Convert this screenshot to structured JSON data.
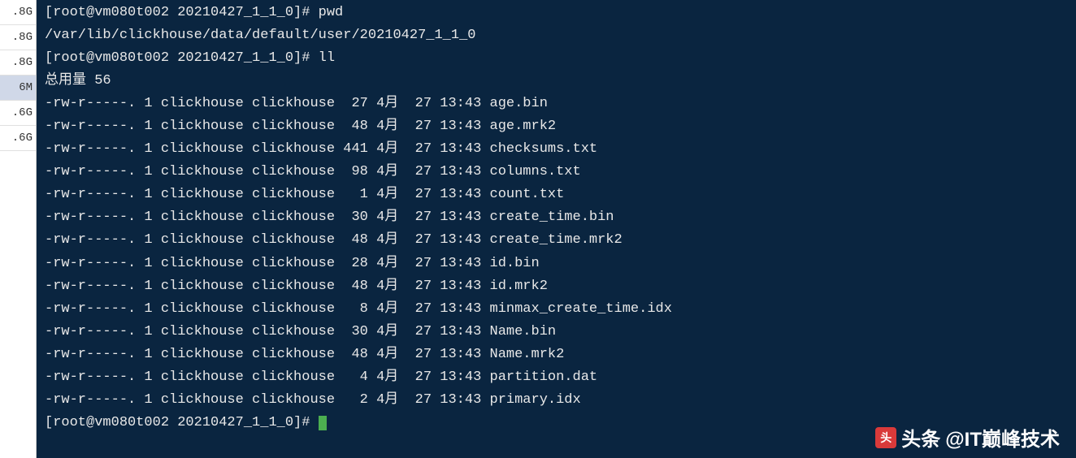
{
  "sidebar": {
    "items": [
      {
        "label": ".8G"
      },
      {
        "label": ".8G"
      },
      {
        "label": ".8G"
      },
      {
        "label": "6M"
      },
      {
        "label": ".6G"
      },
      {
        "label": ".6G"
      }
    ]
  },
  "terminal": {
    "prompt1": "[root@vm080t002 20210427_1_1_0]# ",
    "cmd1": "pwd",
    "path": "/var/lib/clickhouse/data/default/user/20210427_1_1_0",
    "prompt2": "[root@vm080t002 20210427_1_1_0]# ",
    "cmd2": "ll",
    "total": "总用量 56",
    "files": [
      {
        "perms": "-rw-r-----.",
        "links": "1",
        "owner": "clickhouse",
        "group": "clickhouse",
        "size": "27",
        "month": "4月",
        "day": "27",
        "time": "13:43",
        "name": "age.bin"
      },
      {
        "perms": "-rw-r-----.",
        "links": "1",
        "owner": "clickhouse",
        "group": "clickhouse",
        "size": "48",
        "month": "4月",
        "day": "27",
        "time": "13:43",
        "name": "age.mrk2"
      },
      {
        "perms": "-rw-r-----.",
        "links": "1",
        "owner": "clickhouse",
        "group": "clickhouse",
        "size": "441",
        "month": "4月",
        "day": "27",
        "time": "13:43",
        "name": "checksums.txt"
      },
      {
        "perms": "-rw-r-----.",
        "links": "1",
        "owner": "clickhouse",
        "group": "clickhouse",
        "size": "98",
        "month": "4月",
        "day": "27",
        "time": "13:43",
        "name": "columns.txt"
      },
      {
        "perms": "-rw-r-----.",
        "links": "1",
        "owner": "clickhouse",
        "group": "clickhouse",
        "size": "1",
        "month": "4月",
        "day": "27",
        "time": "13:43",
        "name": "count.txt"
      },
      {
        "perms": "-rw-r-----.",
        "links": "1",
        "owner": "clickhouse",
        "group": "clickhouse",
        "size": "30",
        "month": "4月",
        "day": "27",
        "time": "13:43",
        "name": "create_time.bin"
      },
      {
        "perms": "-rw-r-----.",
        "links": "1",
        "owner": "clickhouse",
        "group": "clickhouse",
        "size": "48",
        "month": "4月",
        "day": "27",
        "time": "13:43",
        "name": "create_time.mrk2"
      },
      {
        "perms": "-rw-r-----.",
        "links": "1",
        "owner": "clickhouse",
        "group": "clickhouse",
        "size": "28",
        "month": "4月",
        "day": "27",
        "time": "13:43",
        "name": "id.bin"
      },
      {
        "perms": "-rw-r-----.",
        "links": "1",
        "owner": "clickhouse",
        "group": "clickhouse",
        "size": "48",
        "month": "4月",
        "day": "27",
        "time": "13:43",
        "name": "id.mrk2"
      },
      {
        "perms": "-rw-r-----.",
        "links": "1",
        "owner": "clickhouse",
        "group": "clickhouse",
        "size": "8",
        "month": "4月",
        "day": "27",
        "time": "13:43",
        "name": "minmax_create_time.idx"
      },
      {
        "perms": "-rw-r-----.",
        "links": "1",
        "owner": "clickhouse",
        "group": "clickhouse",
        "size": "30",
        "month": "4月",
        "day": "27",
        "time": "13:43",
        "name": "Name.bin"
      },
      {
        "perms": "-rw-r-----.",
        "links": "1",
        "owner": "clickhouse",
        "group": "clickhouse",
        "size": "48",
        "month": "4月",
        "day": "27",
        "time": "13:43",
        "name": "Name.mrk2"
      },
      {
        "perms": "-rw-r-----.",
        "links": "1",
        "owner": "clickhouse",
        "group": "clickhouse",
        "size": "4",
        "month": "4月",
        "day": "27",
        "time": "13:43",
        "name": "partition.dat"
      },
      {
        "perms": "-rw-r-----.",
        "links": "1",
        "owner": "clickhouse",
        "group": "clickhouse",
        "size": "2",
        "month": "4月",
        "day": "27",
        "time": "13:43",
        "name": "primary.idx"
      }
    ],
    "prompt_end": "[root@vm080t002 20210427_1_1_0]# "
  },
  "watermark": {
    "brand": "头条",
    "handle": "@IT巅峰技术"
  }
}
